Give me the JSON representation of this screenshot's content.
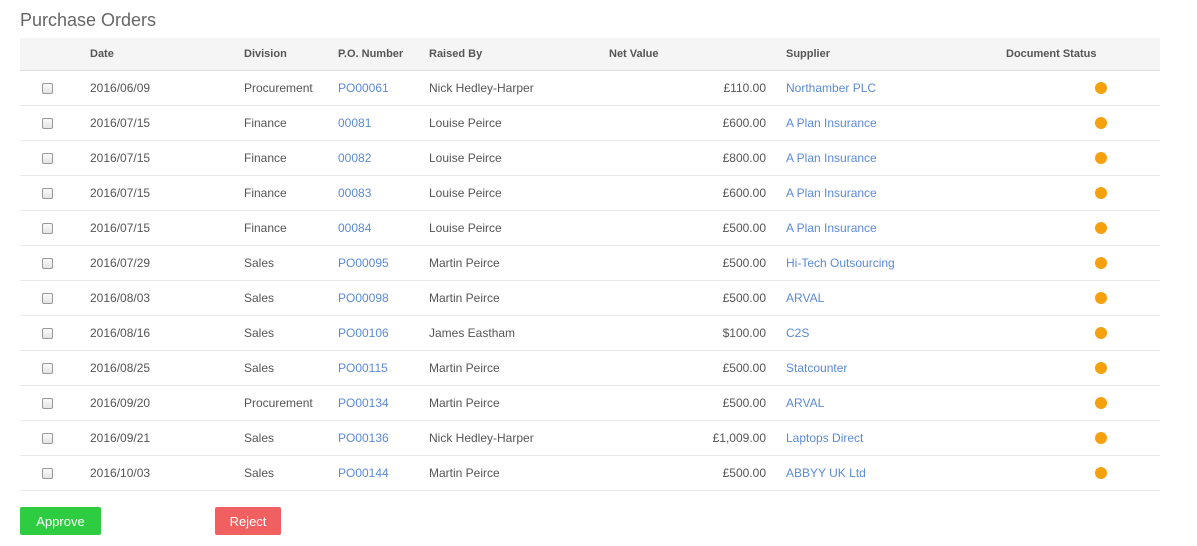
{
  "page": {
    "title": "Purchase Orders"
  },
  "colors": {
    "approve": "#2ecc40",
    "reject": "#f06060",
    "status_pending": "#f5a00f",
    "link": "#5b8ad6"
  },
  "table": {
    "columns": {
      "date": "Date",
      "division": "Division",
      "po_number": "P.O. Number",
      "raised_by": "Raised By",
      "net_value": "Net Value",
      "supplier": "Supplier",
      "document_status": "Document Status"
    },
    "rows": [
      {
        "date": "2016/06/09",
        "division": "Procurement",
        "po_number": "PO00061",
        "raised_by": "Nick Hedley-Harper",
        "net_value": "£110.00",
        "supplier": "Northamber PLC",
        "status_icon": "status-dot-icon"
      },
      {
        "date": "2016/07/15",
        "division": "Finance",
        "po_number": "00081",
        "raised_by": "Louise Peirce",
        "net_value": "£600.00",
        "supplier": "A Plan Insurance",
        "status_icon": "status-dot-icon"
      },
      {
        "date": "2016/07/15",
        "division": "Finance",
        "po_number": "00082",
        "raised_by": "Louise Peirce",
        "net_value": "£800.00",
        "supplier": "A Plan Insurance",
        "status_icon": "status-dot-icon"
      },
      {
        "date": "2016/07/15",
        "division": "Finance",
        "po_number": "00083",
        "raised_by": "Louise Peirce",
        "net_value": "£600.00",
        "supplier": "A Plan Insurance",
        "status_icon": "status-dot-icon"
      },
      {
        "date": "2016/07/15",
        "division": "Finance",
        "po_number": "00084",
        "raised_by": "Louise Peirce",
        "net_value": "£500.00",
        "supplier": "A Plan Insurance",
        "status_icon": "status-dot-icon"
      },
      {
        "date": "2016/07/29",
        "division": "Sales",
        "po_number": "PO00095",
        "raised_by": "Martin Peirce",
        "net_value": "£500.00",
        "supplier": "Hi-Tech Outsourcing",
        "status_icon": "status-dot-icon"
      },
      {
        "date": "2016/08/03",
        "division": "Sales",
        "po_number": "PO00098",
        "raised_by": "Martin Peirce",
        "net_value": "£500.00",
        "supplier": "ARVAL",
        "status_icon": "status-dot-icon"
      },
      {
        "date": "2016/08/16",
        "division": "Sales",
        "po_number": "PO00106",
        "raised_by": "James Eastham",
        "net_value": "$100.00",
        "supplier": "C2S",
        "status_icon": "status-dot-icon"
      },
      {
        "date": "2016/08/25",
        "division": "Sales",
        "po_number": "PO00115",
        "raised_by": "Martin Peirce",
        "net_value": "£500.00",
        "supplier": "Statcounter",
        "status_icon": "status-dot-icon"
      },
      {
        "date": "2016/09/20",
        "division": "Procurement",
        "po_number": "PO00134",
        "raised_by": "Martin Peirce",
        "net_value": "£500.00",
        "supplier": "ARVAL",
        "status_icon": "status-dot-icon"
      },
      {
        "date": "2016/09/21",
        "division": "Sales",
        "po_number": "PO00136",
        "raised_by": "Nick Hedley-Harper",
        "net_value": "£1,009.00",
        "supplier": "Laptops Direct",
        "status_icon": "status-dot-icon"
      },
      {
        "date": "2016/10/03",
        "division": "Sales",
        "po_number": "PO00144",
        "raised_by": "Martin Peirce",
        "net_value": "£500.00",
        "supplier": "ABBYY UK Ltd",
        "status_icon": "status-dot-icon"
      }
    ]
  },
  "actions": {
    "approve_label": "Approve",
    "reject_label": "Reject"
  }
}
